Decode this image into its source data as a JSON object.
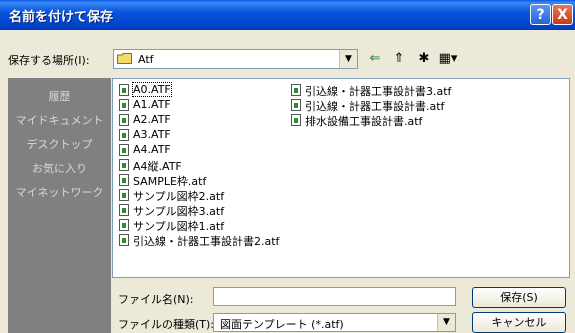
{
  "window": {
    "title": "名前を付けて保存",
    "help": "?",
    "close": "X"
  },
  "location": {
    "label": "保存する場所(I):",
    "value": "Atf",
    "dropdown": "▼"
  },
  "toolbar": {
    "back": "⇐",
    "up": "⇑",
    "new_folder": "✱",
    "view_menu": "▦▾"
  },
  "places": [
    {
      "label": "履歴"
    },
    {
      "label": "マイドキュメント"
    },
    {
      "label": "デスクトップ"
    },
    {
      "label": "お気に入り"
    },
    {
      "label": "マイネットワーク"
    }
  ],
  "files": [
    {
      "name": "A0.ATF",
      "selected": true
    },
    {
      "name": "A1.ATF"
    },
    {
      "name": "A2.ATF"
    },
    {
      "name": "A3.ATF"
    },
    {
      "name": "A4.ATF"
    },
    {
      "name": "A4縦.ATF"
    },
    {
      "name": "SAMPLE枠.atf"
    },
    {
      "name": "サンプル図枠2.atf"
    },
    {
      "name": "サンプル図枠3.atf"
    },
    {
      "name": "サンプル図枠1.atf"
    },
    {
      "name": "引込線・計器工事設計書2.atf"
    },
    {
      "name": "引込線・計器工事設計書3.atf"
    },
    {
      "name": "引込線・計器工事設計書.atf"
    },
    {
      "name": "排水設備工事設計書.atf"
    }
  ],
  "filename": {
    "label": "ファイル名(N):",
    "value": ""
  },
  "filetype": {
    "label": "ファイルの種類(T):",
    "value": "図面テンプレート (*.atf)",
    "dropdown": "▼"
  },
  "buttons": {
    "save": "保存(S)",
    "cancel": "キャンセル"
  }
}
